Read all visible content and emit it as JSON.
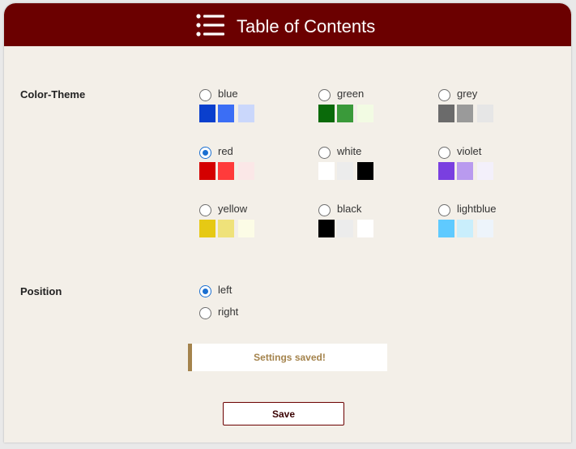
{
  "header": {
    "title": "Table of Contents",
    "icon": "list-icon"
  },
  "color_theme": {
    "label": "Color-Theme",
    "selected": "red",
    "options": [
      {
        "label": "blue",
        "swatches": [
          "#0a3fcd",
          "#3b6ef5",
          "#cad7fb"
        ]
      },
      {
        "label": "green",
        "swatches": [
          "#0a6a0a",
          "#3a9a3a",
          "#f2fbe3"
        ]
      },
      {
        "label": "grey",
        "swatches": [
          "#6b6b6b",
          "#9a9a9a",
          "#e6e6e6"
        ]
      },
      {
        "label": "red",
        "swatches": [
          "#d40000",
          "#ff3b3b",
          "#fbe7e7"
        ]
      },
      {
        "label": "white",
        "swatches": [
          "#ffffff",
          "#ececec",
          "#000000"
        ]
      },
      {
        "label": "violet",
        "swatches": [
          "#7a3fe0",
          "#b99aef",
          "#f3f0fb"
        ]
      },
      {
        "label": "yellow",
        "swatches": [
          "#e6c914",
          "#efe27a",
          "#fcfce6"
        ]
      },
      {
        "label": "black",
        "swatches": [
          "#000000",
          "#ececec",
          "#ffffff"
        ]
      },
      {
        "label": "lightblue",
        "swatches": [
          "#5fcaff",
          "#c9eefc",
          "#edf4fb"
        ]
      }
    ]
  },
  "position": {
    "label": "Position",
    "selected": "left",
    "options": [
      {
        "label": "left"
      },
      {
        "label": "right"
      }
    ]
  },
  "notice": {
    "text": "Settings saved!",
    "accent": "#a4834c"
  },
  "actions": {
    "save_label": "Save"
  },
  "colors": {
    "header_bg": "#6b0000",
    "panel_bg": "#f3efe8",
    "radio_checked": "#1a6fd1"
  }
}
